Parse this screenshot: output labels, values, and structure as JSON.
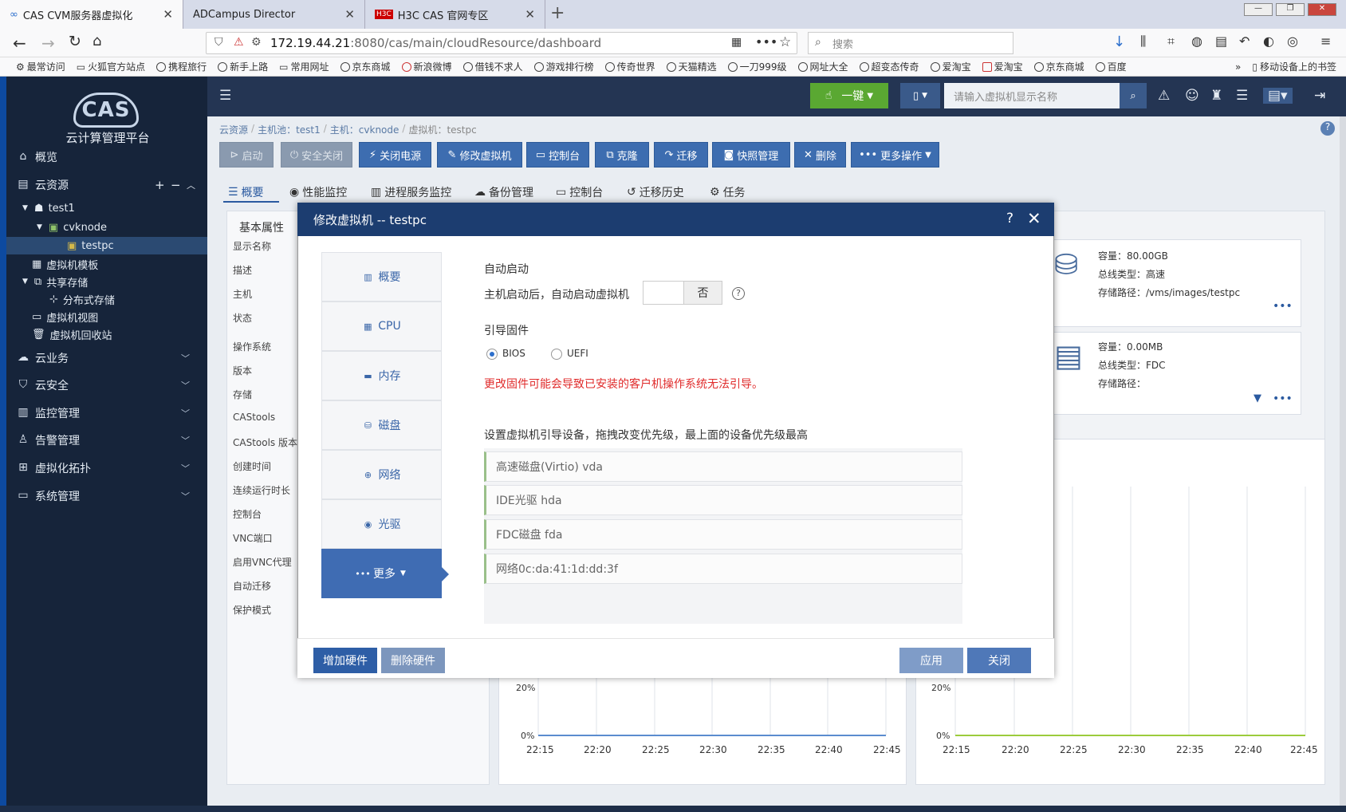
{
  "browser": {
    "tabs": [
      {
        "title": "CAS CVM服务器虚拟化",
        "active": true
      },
      {
        "title": "ADCampus Director",
        "active": false
      },
      {
        "title": "H3C CAS 官网专区",
        "active": false
      }
    ],
    "url_host": "172.19.44.21",
    "url_rest": ":8080/cas/main/cloudResource/dashboard",
    "search_placeholder": "搜索",
    "bookmarks": [
      "最常访问",
      "火狐官方站点",
      "携程旅行",
      "新手上路",
      "常用网址",
      "京东商城",
      "新浪微博",
      "借钱不求人",
      "游戏排行榜",
      "传奇世界",
      "天猫精选",
      "一刀999级",
      "网址大全",
      "超变态传奇",
      "爱淘宝",
      "爱淘宝",
      "京东商城",
      "百度"
    ],
    "mobile_bookmarks": "移动设备上的书签"
  },
  "app": {
    "brand": "云计算管理平台",
    "logo_text": "CAS",
    "nav": {
      "overview": "概览",
      "cloud_resource": "云资源",
      "tree": {
        "host_pool": "test1",
        "host": "cvknode",
        "vm": "testpc",
        "vm_template": "虚拟机模板",
        "shared_storage": "共享存储",
        "dist_storage": "分布式存储",
        "vm_view": "虚拟机视图",
        "vm_recycle": "虚拟机回收站"
      },
      "cloud_business": "云业务",
      "cloud_security": "云安全",
      "monitor": "监控管理",
      "alarm": "告警管理",
      "topology": "虚拟化拓扑",
      "system": "系统管理"
    },
    "header": {
      "onekey": "一键",
      "vm_search_placeholder": "请输入虚拟机显示名称"
    },
    "breadcrumb": [
      "云资源",
      "主机池：test1",
      "主机：cvknode",
      "虚拟机：testpc"
    ],
    "toolbar": {
      "start": "启动",
      "safe_shutdown": "安全关闭",
      "power_off": "关闭电源",
      "modify_vm": "修改虚拟机",
      "console": "控制台",
      "clone": "克隆",
      "migrate": "迁移",
      "snapshot": "快照管理",
      "delete": "删除",
      "more": "更多操作"
    },
    "tabs": [
      "概要",
      "性能监控",
      "进程服务监控",
      "备份管理",
      "控制台",
      "迁移历史",
      "任务"
    ],
    "basic_props": {
      "title": "基本属性",
      "labels": [
        "显示名称",
        "描述",
        "主机",
        "状态",
        "操作系统",
        "版本",
        "存储",
        "CAStools",
        "CAStools 版本",
        "创建时间",
        "连续运行时长",
        "控制台",
        "VNC端口",
        "启用VNC代理",
        "自动迁移",
        "保护模式"
      ]
    },
    "disk_card": {
      "capacity": "容量：80.00GB",
      "bus": "总线类型：高速",
      "path": "存储路径：/vms/images/testpc"
    },
    "floppy_card": {
      "capacity": "容量：0.00MB",
      "bus": "总线类型：FDC",
      "path": "存储路径："
    },
    "charts": {
      "y_labels": [
        "20%",
        "0%"
      ],
      "x_labels": [
        "22:15",
        "22:20",
        "22:25",
        "22:30",
        "22:35",
        "22:40",
        "22:45"
      ]
    }
  },
  "modal": {
    "title": "修改虚拟机 -- testpc",
    "nav": [
      "概要",
      "CPU",
      "内存",
      "磁盘",
      "网络",
      "光驱",
      "更多"
    ],
    "auto_start_title": "自动启动",
    "auto_start_label": "主机启动后，自动启动虚拟机",
    "auto_start_value": "否",
    "firmware_title": "引导固件",
    "firmware_options": [
      "BIOS",
      "UEFI"
    ],
    "firmware_selected": "BIOS",
    "firmware_warning": "更改固件可能会导致已安装的客户机操作系统无法引导。",
    "boot_order_title": "设置虚拟机引导设备，拖拽改变优先级，最上面的设备优先级最高",
    "boot_devices": [
      "高速磁盘(Virtio) vda",
      "IDE光驱 hda",
      "FDC磁盘 fda",
      "网络0c:da:41:1d:dd:3f"
    ],
    "buttons": {
      "add_hw": "增加硬件",
      "del_hw": "删除硬件",
      "apply": "应用",
      "close": "关闭"
    }
  }
}
